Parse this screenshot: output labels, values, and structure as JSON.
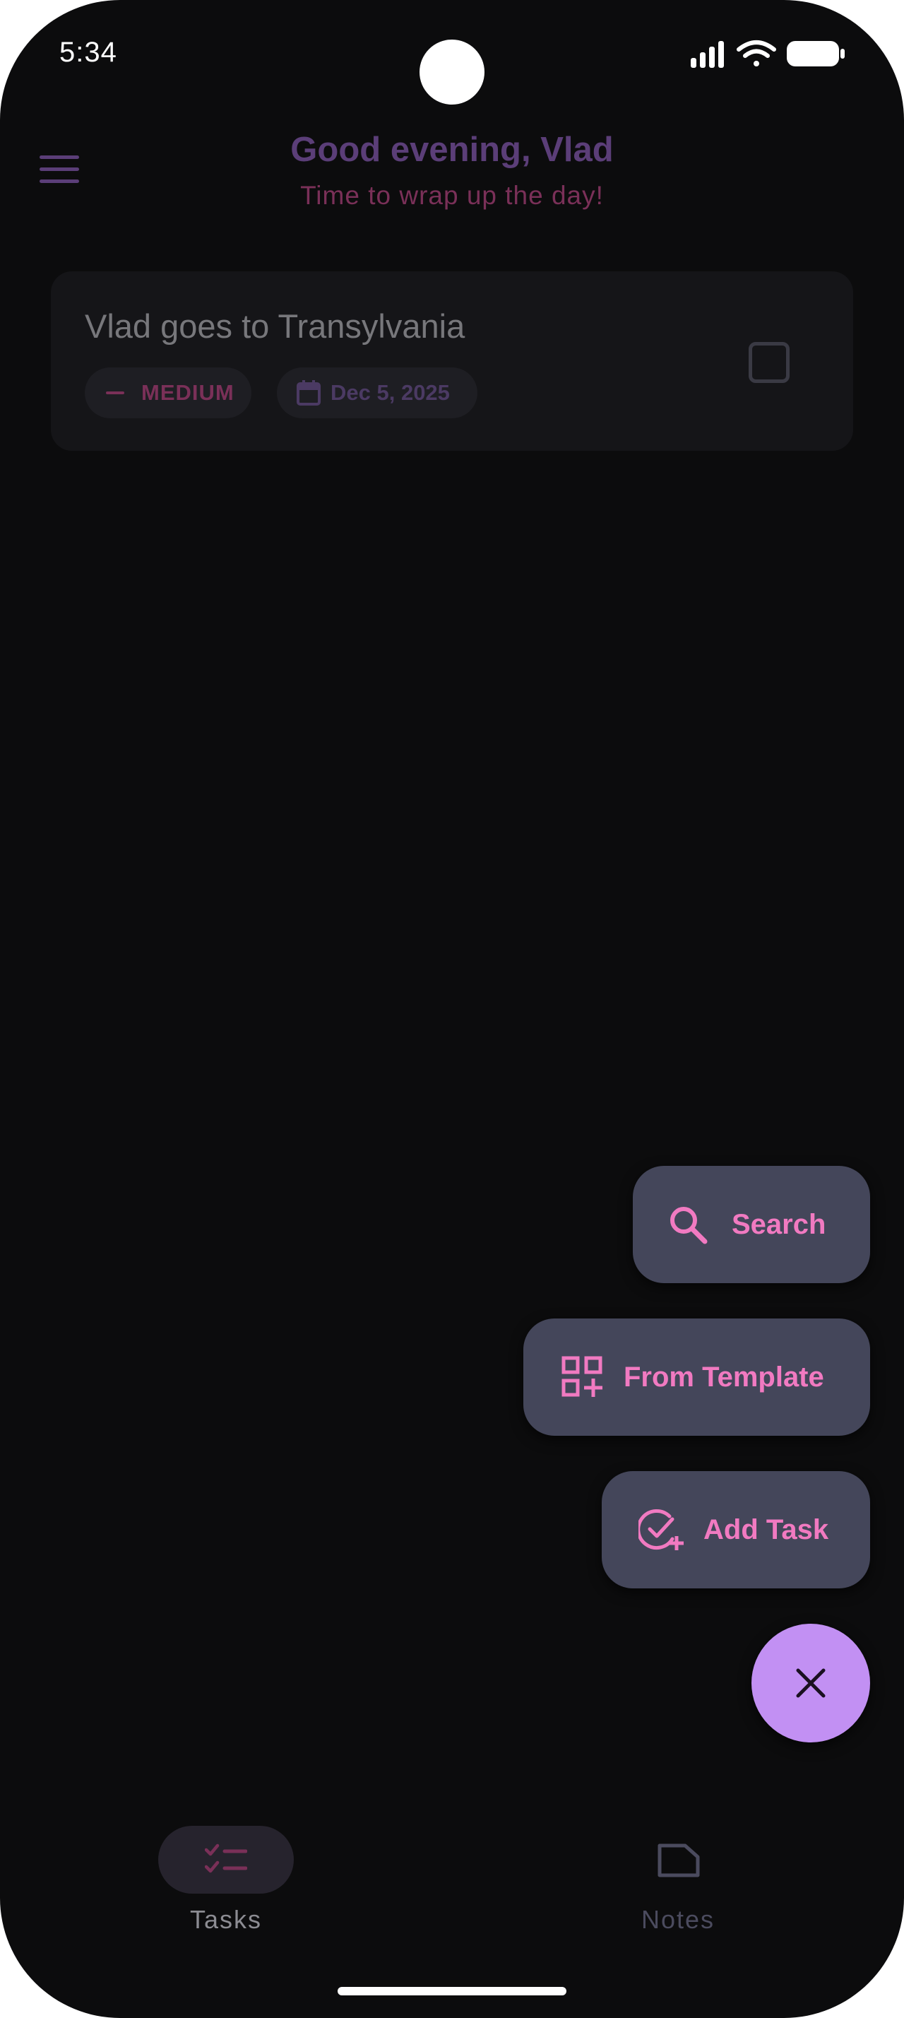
{
  "status_bar": {
    "time": "5:34",
    "icons": [
      "signal-icon",
      "wifi-icon",
      "battery-icon"
    ]
  },
  "header": {
    "menu_icon": "menu-icon",
    "greeting": "Good evening, Vlad",
    "subtitle": "Time to wrap up the day!"
  },
  "tasks": [
    {
      "title": "Vlad goes to Transylvania",
      "priority": "MEDIUM",
      "priority_icon": "dash-icon",
      "due_date": "Dec 5, 2025",
      "date_icon": "calendar-icon",
      "completed": false
    }
  ],
  "fab_menu": {
    "items": [
      {
        "label": "Search",
        "icon": "search-icon"
      },
      {
        "label": "From Template",
        "icon": "template-icon"
      },
      {
        "label": "Add Task",
        "icon": "add-task-icon"
      }
    ],
    "close_icon": "close-icon"
  },
  "bottom_nav": {
    "items": [
      {
        "label": "Tasks",
        "icon": "checklist-icon",
        "active": true
      },
      {
        "label": "Notes",
        "icon": "note-icon",
        "active": false
      }
    ]
  },
  "colors": {
    "background": "#0c0c0d",
    "greeting": "#5b3e78",
    "subtitle": "#7a3058",
    "card": "#151518",
    "fab_item": "#44465a",
    "fab_text": "#f17ac1",
    "fab_close": "#c290f3"
  }
}
